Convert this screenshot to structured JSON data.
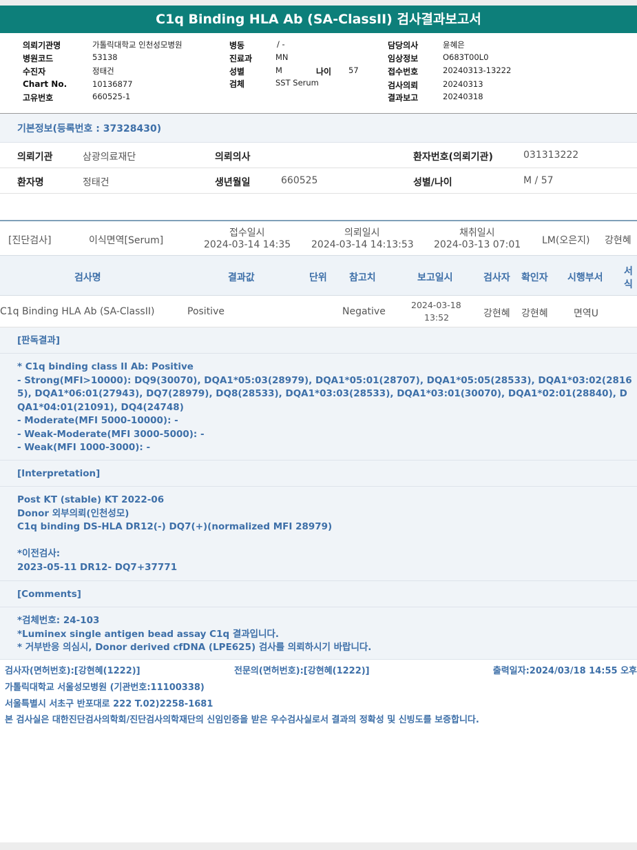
{
  "report": {
    "title": "C1q Binding HLA Ab (SA-ClassII) 검사결과보고서"
  },
  "header": {
    "institution_label": "의뢰기관명",
    "institution_value": "가톨릭대학교 인천성모병원",
    "hospital_code_label": "병원코드",
    "hospital_code_value": "53138",
    "patient_label": "수진자",
    "patient_value": "정태건",
    "chart_label": "Chart No.",
    "chart_value": "10136877",
    "unique_label": "고유번호",
    "unique_value": "660525-1",
    "ward_label": "병동",
    "ward_value": "/ -",
    "dept_label": "진료과",
    "dept_value": "MN",
    "sex_label": "성별",
    "sex_value": "M",
    "age_label": "나이",
    "age_value": "57",
    "specimen_label": "검체",
    "specimen_value": "SST Serum",
    "doctor_label": "담당의사",
    "doctor_value": "윤혜은",
    "clinical_label": "임상정보",
    "clinical_value": "O683T00L0",
    "receipt_label": "접수번호",
    "receipt_value": "20240313-13222",
    "request_label": "검사의뢰",
    "request_value": "20240313",
    "report_label": "결과보고",
    "report_value": "20240318"
  },
  "basic_info": {
    "title": "기본정보(등록번호 : 37328430)",
    "req_inst_label": "의뢰기관",
    "req_inst_value": "삼광의료재단",
    "req_doc_label": "의뢰의사",
    "req_doc_value": "",
    "pt_no_label": "환자번호(의뢰기관)",
    "pt_no_value": "031313222",
    "pt_name_label": "환자명",
    "pt_name_value": "정태건",
    "dob_label": "생년월일",
    "dob_value": "660525",
    "sex_age_label": "성별/나이",
    "sex_age_value": "M / 57"
  },
  "diagnosis": {
    "category": "[진단검사]",
    "test_group": "이식면역[Serum]",
    "receipt_date_label": "접수일시",
    "receipt_date_value": "2024-03-14 14:35",
    "request_date_label": "의뢰일시",
    "request_date_value": "2024-03-14 14:13:53",
    "collect_date_label": "채취일시",
    "collect_date_value": "2024-03-13 07:01",
    "lm": "LM(오은지)",
    "examiner": "강현혜"
  },
  "table": {
    "headers": [
      "검사명",
      "결과값",
      "단위",
      "참고치",
      "보고일시",
      "검사자",
      "확인자",
      "시행부서",
      "서",
      "식"
    ],
    "row": {
      "test_name": "C1q Binding HLA Ab (SA-ClassII)",
      "result": "Positive",
      "unit": "",
      "reference": "Negative",
      "report_date": "2024-03-18",
      "report_time": "13:52",
      "tester": "강현혜",
      "verifier": "강현혜",
      "department": "면역U"
    }
  },
  "interpretation_result": {
    "header": "[판독결과]",
    "lines": [
      "* C1q binding class II Ab: Positive",
      "- Strong(MFI>10000): DQ9(30070), DQA1*05:03(28979), DQA1*05:01(28707), DQA1*05:05(28533), DQA1*03:02(28165), DQA1*06:01(27943), DQ7(28979), DQ8(28533), DQA1*03:03(28533), DQA1*03:01(30070), DQA1*02:01(28840), DQA1*04:01(21091), DQ4(24748)",
      "- Moderate(MFI 5000-10000): -",
      "- Weak-Moderate(MFI 3000-5000): -",
      "- Weak(MFI 1000-3000): -"
    ]
  },
  "interpretation": {
    "header": "[Interpretation]",
    "lines": [
      "Post KT (stable) KT 2022-06",
      "Donor 외부의뢰(인천성모)",
      "C1q binding DS-HLA DR12(-) DQ7(+)(normalized MFI 28979)",
      "",
      "*이전검사:",
      "2023-05-11 DR12- DQ7+37771"
    ]
  },
  "comments": {
    "header": "[Comments]",
    "lines": [
      "*검체번호: 24-103",
      "*Luminex single antigen bead assay C1q 결과입니다.",
      "* 거부반응 의심시, Donor derived cfDNA (LPE625) 검사를 의뢰하시기 바랍니다."
    ]
  },
  "footer": {
    "examiner": "검사자(면허번호):[강현혜(1222)]",
    "specialist": "전문의(면허번호):[강현혜(1222)]",
    "print_date": "출력일자:2024/03/18 14:55 오후",
    "hospital": "가톨릭대학교 서울성모병원 (기관번호:11100338)",
    "address": "서울특별시 서초구 반포대로 222 T.02)2258-1681",
    "certification": "본 검사실은 대한진단검사의학회/진단검사의학재단의 신임인증을 받은 우수검사실로서 결과의 정확성 및 신빙도를 보증합니다."
  }
}
